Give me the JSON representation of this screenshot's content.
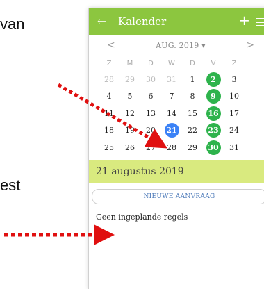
{
  "background": {
    "text_top": "van",
    "text_bottom": "est"
  },
  "app": {
    "appbar": {
      "back_icon": "arrow-left-icon",
      "title": "Kalender",
      "plus_label": "+",
      "menu_icon": "menu-icon",
      "color": "#8cc63f"
    },
    "calendar": {
      "prev": "<",
      "month_label": "AUG. 2019 ▾",
      "next": ">",
      "weekdays": [
        "Z",
        "M",
        "D",
        "W",
        "D",
        "V",
        "Z"
      ],
      "weeks": [
        [
          {
            "d": "28",
            "s": "muted"
          },
          {
            "d": "29",
            "s": "muted"
          },
          {
            "d": "30",
            "s": "muted"
          },
          {
            "d": "31",
            "s": "muted"
          },
          {
            "d": "1",
            "s": ""
          },
          {
            "d": "2",
            "s": "green"
          },
          {
            "d": "3",
            "s": ""
          }
        ],
        [
          {
            "d": "4",
            "s": ""
          },
          {
            "d": "5",
            "s": ""
          },
          {
            "d": "6",
            "s": ""
          },
          {
            "d": "7",
            "s": ""
          },
          {
            "d": "8",
            "s": ""
          },
          {
            "d": "9",
            "s": "green"
          },
          {
            "d": "10",
            "s": ""
          }
        ],
        [
          {
            "d": "11",
            "s": ""
          },
          {
            "d": "12",
            "s": ""
          },
          {
            "d": "13",
            "s": ""
          },
          {
            "d": "14",
            "s": ""
          },
          {
            "d": "15",
            "s": ""
          },
          {
            "d": "16",
            "s": "green"
          },
          {
            "d": "17",
            "s": ""
          }
        ],
        [
          {
            "d": "18",
            "s": ""
          },
          {
            "d": "19",
            "s": ""
          },
          {
            "d": "20",
            "s": ""
          },
          {
            "d": "21",
            "s": "selected"
          },
          {
            "d": "22",
            "s": ""
          },
          {
            "d": "23",
            "s": "green"
          },
          {
            "d": "24",
            "s": ""
          }
        ],
        [
          {
            "d": "25",
            "s": ""
          },
          {
            "d": "26",
            "s": ""
          },
          {
            "d": "27",
            "s": ""
          },
          {
            "d": "28",
            "s": ""
          },
          {
            "d": "29",
            "s": ""
          },
          {
            "d": "30",
            "s": "green"
          },
          {
            "d": "31",
            "s": ""
          }
        ]
      ],
      "colors": {
        "green": "#2eb34c",
        "selected": "#3b82f6"
      }
    },
    "selected_date_label": "21 augustus 2019",
    "new_request_label": "NIEUWE AANVRAAG",
    "no_rules_text": "Geen ingeplande regels"
  },
  "annotations": {
    "arrow_color": "#e01010"
  }
}
